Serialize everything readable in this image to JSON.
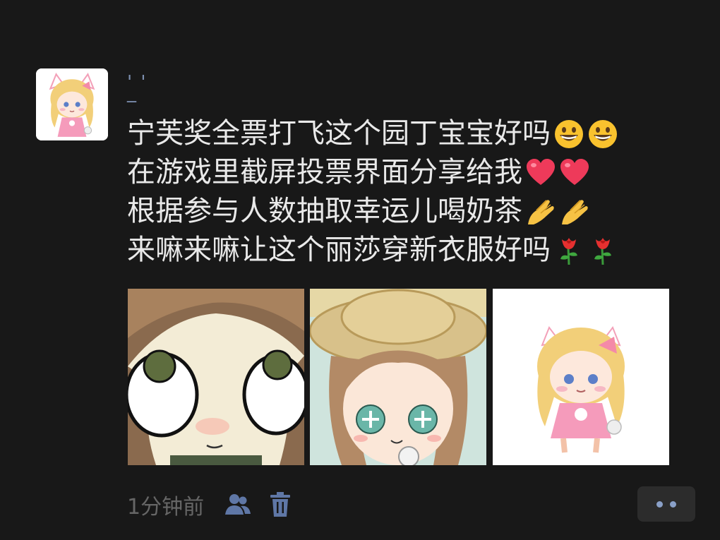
{
  "post": {
    "username_line1": "' '",
    "username_line2": "_",
    "lines": [
      {
        "text": "宁芙奖全票打飞这个园丁宝宝好吗",
        "emojis": [
          "grinning-face-emoji",
          "grinning-face-emoji"
        ]
      },
      {
        "text": "在游戏里截屏投票界面分享给我",
        "emojis": [
          "red-heart-emoji",
          "red-heart-emoji"
        ]
      },
      {
        "text": "根据参与人数抽取幸运儿喝奶茶",
        "emojis": [
          "pinched-fingers-emoji",
          "pinched-fingers-emoji"
        ]
      },
      {
        "text": "来嘛来嘛让这个丽莎穿新衣服好吗",
        "emojis": [
          "rose-emoji",
          "rose-emoji"
        ]
      }
    ],
    "photos": [
      "gardener-closeup-portrait",
      "gardener-straw-hat-portrait",
      "pink-chibi-girl-sticker"
    ],
    "time_label": "1分钟前",
    "icons": {
      "visibility": "people-icon",
      "delete": "trash-icon",
      "more": "more-dots-icon"
    }
  },
  "colors": {
    "background": "#181818",
    "text": "#e9e9e9",
    "username": "#7d8fb0",
    "meta_text": "#666666",
    "meta_icon": "#5f77a6",
    "more_button_bg": "#2c2c2c"
  }
}
